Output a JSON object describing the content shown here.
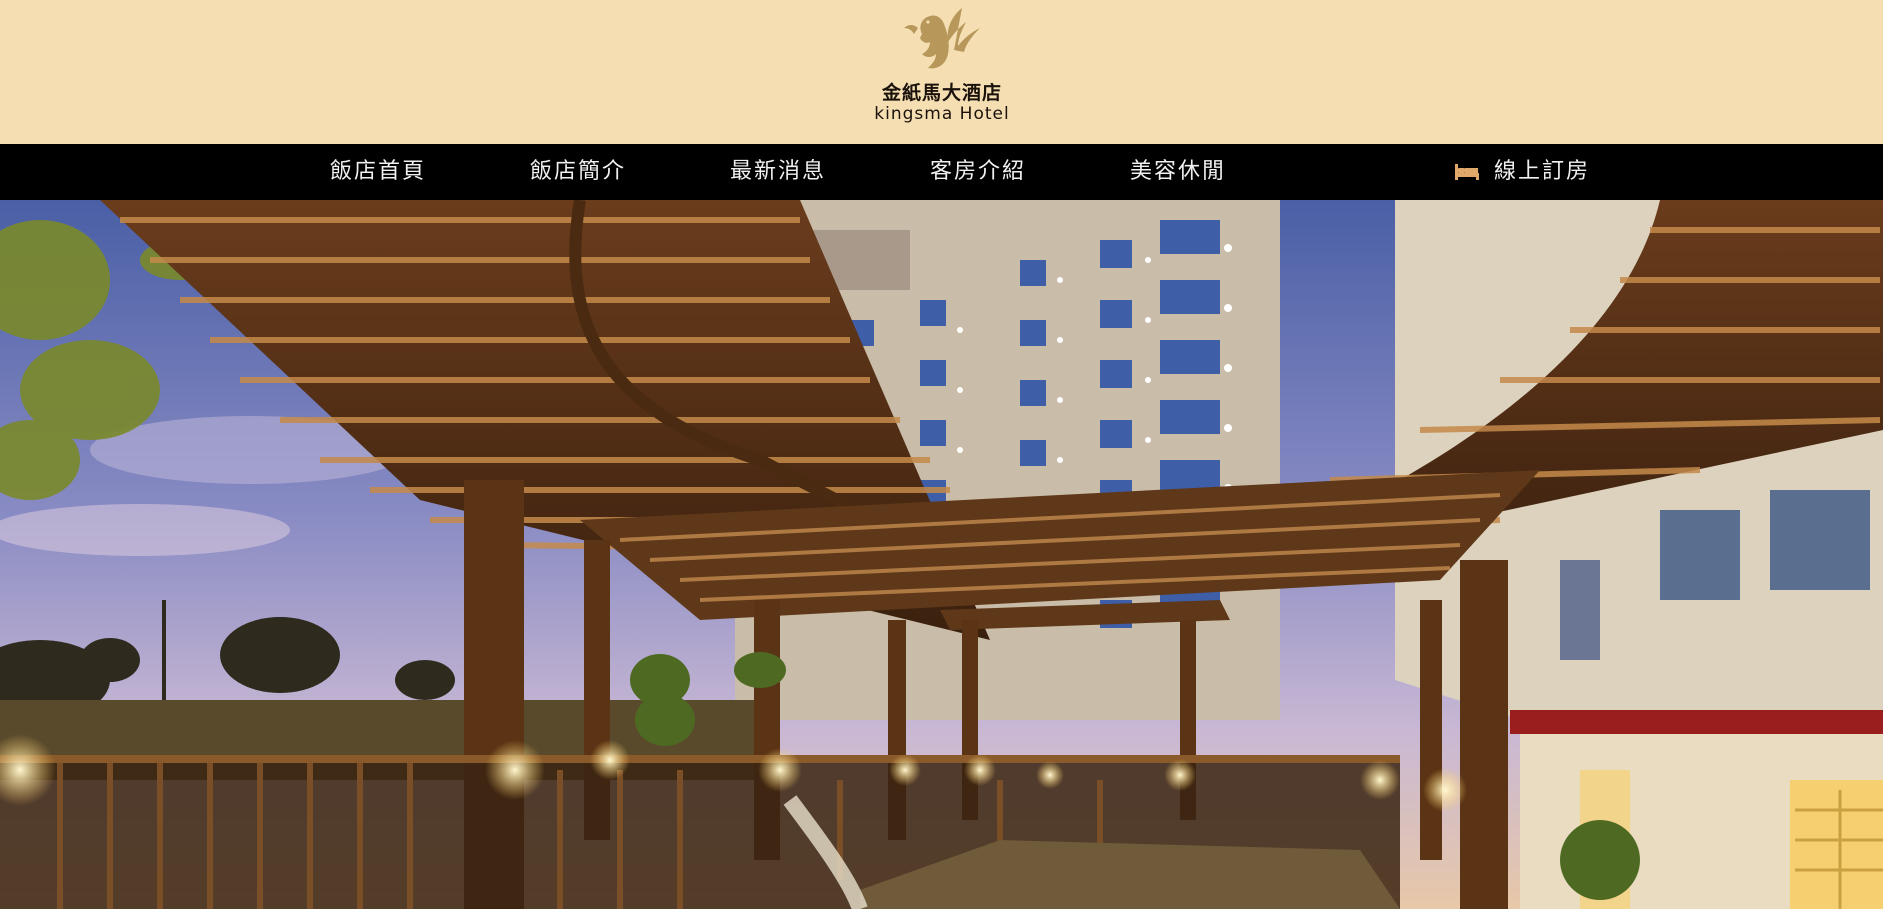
{
  "logo": {
    "name_cn": "金紙馬大酒店",
    "name_en": "kingsma Hotel",
    "icon": "pegasus-horse-icon"
  },
  "nav": {
    "items": [
      {
        "label": "飯店首頁"
      },
      {
        "label": "飯店簡介"
      },
      {
        "label": "最新消息"
      },
      {
        "label": "客房介紹"
      },
      {
        "label": "美容休閒"
      }
    ],
    "booking": {
      "label": "線上訂房",
      "icon": "bed-icon"
    }
  },
  "hero": {
    "image": "hotel-exterior-pergola-photo"
  },
  "colors": {
    "header_bg": "#f4deb2",
    "nav_bg": "#000000",
    "logo_gold": "#b8985a",
    "nav_text": "#f0f0f0",
    "booking_icon": "#e0a96a"
  }
}
